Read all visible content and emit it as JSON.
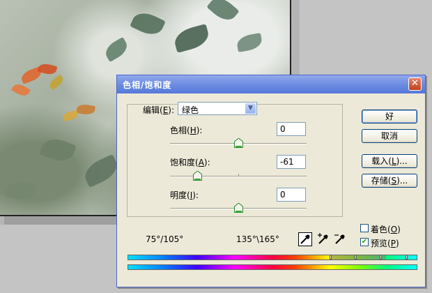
{
  "dialog": {
    "title": "色相/饱和度",
    "edit": {
      "label_pre": "编辑(",
      "mnemonic": "E",
      "label_post": "):",
      "value": "绿色"
    },
    "hue": {
      "label_pre": "色相(",
      "mnemonic": "H",
      "label_post": "):",
      "value": "0",
      "slider": 0.5
    },
    "saturation": {
      "label_pre": "饱和度(",
      "mnemonic": "A",
      "label_post": "):",
      "value": "-61",
      "slider": 0.2
    },
    "lightness": {
      "label_pre": "明度(",
      "mnemonic": "I",
      "label_post": "):",
      "value": "0",
      "slider": 0.5
    },
    "buttons": {
      "ok": "好",
      "cancel": "取消",
      "load_pre": "载入(",
      "load_mn": "L",
      "load_post": ")...",
      "save_pre": "存储(",
      "save_mn": "S",
      "save_post": ")..."
    },
    "colorize": {
      "label_pre": "着色(",
      "mnemonic": "O",
      "label_post": ")",
      "checked": false
    },
    "preview": {
      "label_pre": "预览(",
      "mnemonic": "P",
      "label_post": ")",
      "checked": true
    },
    "range_left": "75°/105°",
    "range_right": "135°\\165°",
    "icons": [
      "eyedropper-icon",
      "eyedropper-plus-icon",
      "eyedropper-minus-icon"
    ]
  },
  "colors": {
    "titlebar": "#6f8fe2",
    "dialog_bg": "#ece9d8",
    "close": "#c3401b"
  }
}
